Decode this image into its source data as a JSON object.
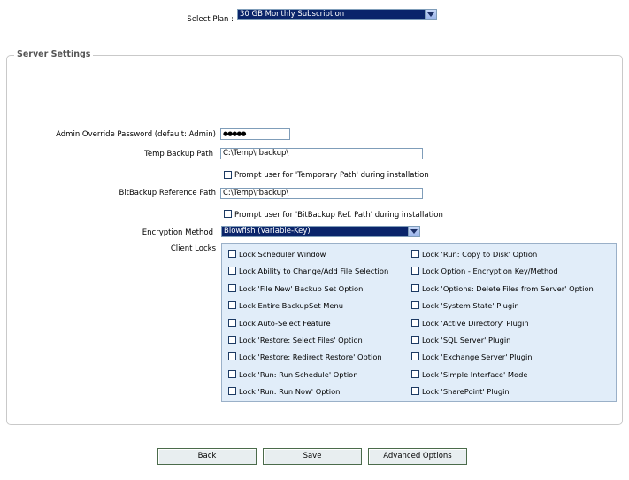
{
  "plan": {
    "label": "Select Plan :",
    "selected": "30 GB Monthly Subscription"
  },
  "server_settings": {
    "legend": "Server Settings",
    "admin_password": {
      "label": "Admin Override Password (default: Admin)",
      "value": "●●●●●"
    },
    "temp_backup_path": {
      "label": "Temp Backup Path",
      "value": "C:\\Temp\\rbackup\\"
    },
    "prompt_temp": "Prompt user for 'Temporary Path' during installation",
    "bitbackup_path": {
      "label": "BitBackup Reference Path",
      "value": "C:\\Temp\\rbackup\\"
    },
    "prompt_bitbackup": "Prompt user for 'BitBackup Ref. Path' during installation",
    "encryption": {
      "label": "Encryption Method",
      "selected": "Blowfish (Variable-Key)"
    },
    "client_locks_label": "Client Locks",
    "locks_left": [
      "Lock Scheduler Window",
      "Lock Ability to Change/Add File Selection",
      "Lock 'File New' Backup Set Option",
      "Lock Entire BackupSet Menu",
      "Lock Auto-Select Feature",
      "Lock 'Restore: Select Files' Option",
      "Lock 'Restore: Redirect Restore' Option",
      "Lock 'Run: Run Schedule' Option",
      "Lock 'Run: Run Now' Option"
    ],
    "locks_right": [
      "Lock 'Run: Copy to Disk' Option",
      "Lock Option - Encryption Key/Method",
      "Lock 'Options: Delete Files from Server' Option",
      "Lock 'System State' Plugin",
      "Lock 'Active Directory' Plugin",
      "Lock 'SQL Server' Plugin",
      "Lock 'Exchange Server' Plugin",
      "Lock 'Simple Interface' Mode",
      "Lock 'SharePoint' Plugin"
    ]
  },
  "buttons": {
    "back": "Back",
    "save": "Save",
    "advanced": "Advanced Options"
  }
}
